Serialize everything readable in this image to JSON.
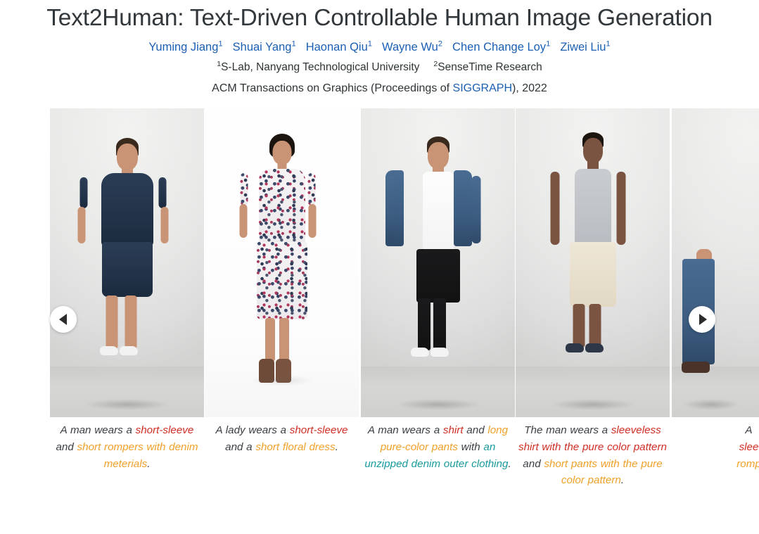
{
  "header": {
    "title": "Text2Human: Text-Driven Controllable Human Image Generation",
    "authors": [
      {
        "name": "Yuming Jiang",
        "sup": "1"
      },
      {
        "name": "Shuai Yang",
        "sup": "1"
      },
      {
        "name": "Haonan Qiu",
        "sup": "1"
      },
      {
        "name": "Wayne Wu",
        "sup": "2"
      },
      {
        "name": "Chen Change Loy",
        "sup": "1"
      },
      {
        "name": "Ziwei Liu",
        "sup": "1"
      }
    ],
    "affiliations": [
      {
        "sup": "1",
        "name": "S-Lab, Nanyang Technological University"
      },
      {
        "sup": "2",
        "name": "SenseTime Research"
      }
    ],
    "venue_prefix": "ACM Transactions on Graphics (Proceedings of ",
    "venue_link": "SIGGRAPH",
    "venue_suffix": "), 2022"
  },
  "colors": {
    "author_blue": "#1b5fb4",
    "link_blue": "#1b5fb4",
    "title_dark": "#32373b",
    "caption_red": "#cf2f26",
    "caption_orange": "#f0a12a",
    "caption_teal": "#1a9a9c",
    "caption_grey": "#3b4045",
    "page_background": "#ffffff"
  },
  "carousel": {
    "prev_button": {
      "icon": "chevron-left-icon",
      "label": "Previous"
    },
    "next_button": {
      "icon": "chevron-right-icon",
      "label": "Next"
    },
    "slides": [
      {
        "id": "slide-1",
        "alt": "Man in dark denim short-sleeve romper standing in studio",
        "caption_parts": [
          {
            "text": "A man wears a ",
            "color": "grey"
          },
          {
            "text": "short-sleeve",
            "color": "red"
          },
          {
            "text": " and ",
            "color": "grey"
          },
          {
            "text": "short rompers with denim meterials",
            "color": "orange"
          },
          {
            "text": ".",
            "color": "grey"
          }
        ]
      },
      {
        "id": "slide-2",
        "alt": "Lady in short-sleeve floral dress with heeled boots",
        "caption_parts": [
          {
            "text": "A lady wears a ",
            "color": "grey"
          },
          {
            "text": "short-sleeve",
            "color": "red"
          },
          {
            "text": " and a ",
            "color": "grey"
          },
          {
            "text": "short floral dress",
            "color": "orange"
          },
          {
            "text": ".",
            "color": "grey"
          }
        ]
      },
      {
        "id": "slide-3",
        "alt": "Man in white shirt, black pants and open denim jacket",
        "caption_parts": [
          {
            "text": "A man wears a ",
            "color": "grey"
          },
          {
            "text": "shirt",
            "color": "red"
          },
          {
            "text": " and ",
            "color": "grey"
          },
          {
            "text": "long pure-color pants",
            "color": "orange"
          },
          {
            "text": " with ",
            "color": "grey"
          },
          {
            "text": "an unzipped denim outer clothing",
            "color": "teal"
          },
          {
            "text": ".",
            "color": "grey"
          }
        ]
      },
      {
        "id": "slide-4",
        "alt": "Man in grey sleeveless tank top and beige shorts",
        "caption_parts": [
          {
            "text": "The man wears a ",
            "color": "grey"
          },
          {
            "text": "sleeveless shirt with the pure color pattern",
            "color": "red"
          },
          {
            "text": " and ",
            "color": "grey"
          },
          {
            "text": "short pants with the pure color pattern",
            "color": "orange"
          },
          {
            "text": ".",
            "color": "grey"
          }
        ]
      },
      {
        "id": "slide-5",
        "alt": "Partially visible person in blue denim jeans and sandals",
        "caption_parts": [
          {
            "text": "A ",
            "color": "grey"
          },
          {
            "text": "slee",
            "color": "red"
          },
          {
            "text": "romp",
            "color": "orange"
          }
        ]
      }
    ]
  }
}
